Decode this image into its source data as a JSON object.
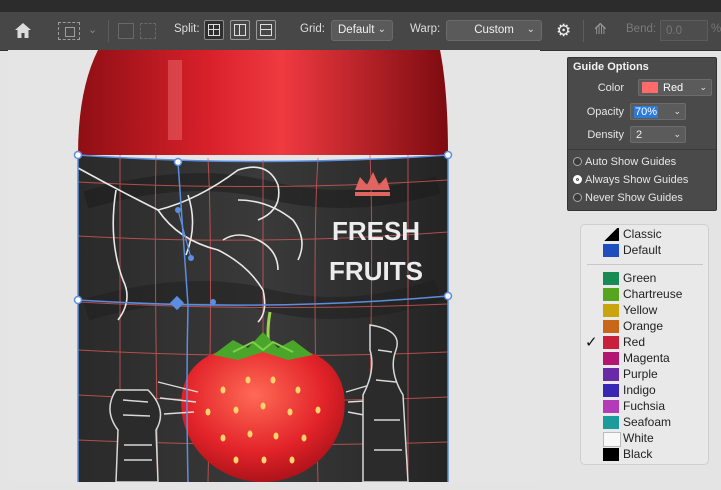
{
  "toolbar": {
    "split_label": "Split:",
    "grid_label": "Grid:",
    "grid_value": "Default",
    "warp_label": "Warp:",
    "warp_value": "Custom",
    "bend_label": "Bend:",
    "bend_value": "0.0",
    "bend_unit": "%",
    "icons": [
      "home-icon",
      "warp-transform-icon",
      "split-crosswise-icon",
      "split-vertical-icon",
      "split-horizontal-icon",
      "gear-icon",
      "bend-icon"
    ]
  },
  "artwork": {
    "label_line1": "FRESH",
    "label_line2": "FRUITS"
  },
  "guide_options": {
    "title": "Guide Options",
    "color_label": "Color",
    "color_value": "Red",
    "color_swatch": "#ff6b6b",
    "opacity_label": "Opacity",
    "opacity_value": "70%",
    "density_label": "Density",
    "density_value": "2",
    "radios": [
      {
        "label": "Auto Show Guides",
        "checked": false
      },
      {
        "label": "Always Show Guides",
        "checked": true
      },
      {
        "label": "Never Show Guides",
        "checked": false
      }
    ]
  },
  "color_menu": {
    "items": [
      {
        "label": "Classic",
        "color": "#000000",
        "checked": false
      },
      {
        "label": "Default",
        "color": "#1f4fbf",
        "checked": false
      },
      {
        "label": "Green",
        "color": "#1a8a55",
        "checked": false
      },
      {
        "label": "Chartreuse",
        "color": "#55a51e",
        "checked": false
      },
      {
        "label": "Yellow",
        "color": "#c9a40f",
        "checked": false
      },
      {
        "label": "Orange",
        "color": "#c8661a",
        "checked": false
      },
      {
        "label": "Red",
        "color": "#c8203a",
        "checked": true
      },
      {
        "label": "Magenta",
        "color": "#b31670",
        "checked": false
      },
      {
        "label": "Purple",
        "color": "#6a2aa8",
        "checked": false
      },
      {
        "label": "Indigo",
        "color": "#3a26b4",
        "checked": false
      },
      {
        "label": "Fuchsia",
        "color": "#b33ab8",
        "checked": false
      },
      {
        "label": "Seafoam",
        "color": "#1a9c9c",
        "checked": false
      },
      {
        "label": "White",
        "color": "#f8f8f8",
        "checked": false
      },
      {
        "label": "Black",
        "color": "#000000",
        "checked": false
      }
    ]
  }
}
